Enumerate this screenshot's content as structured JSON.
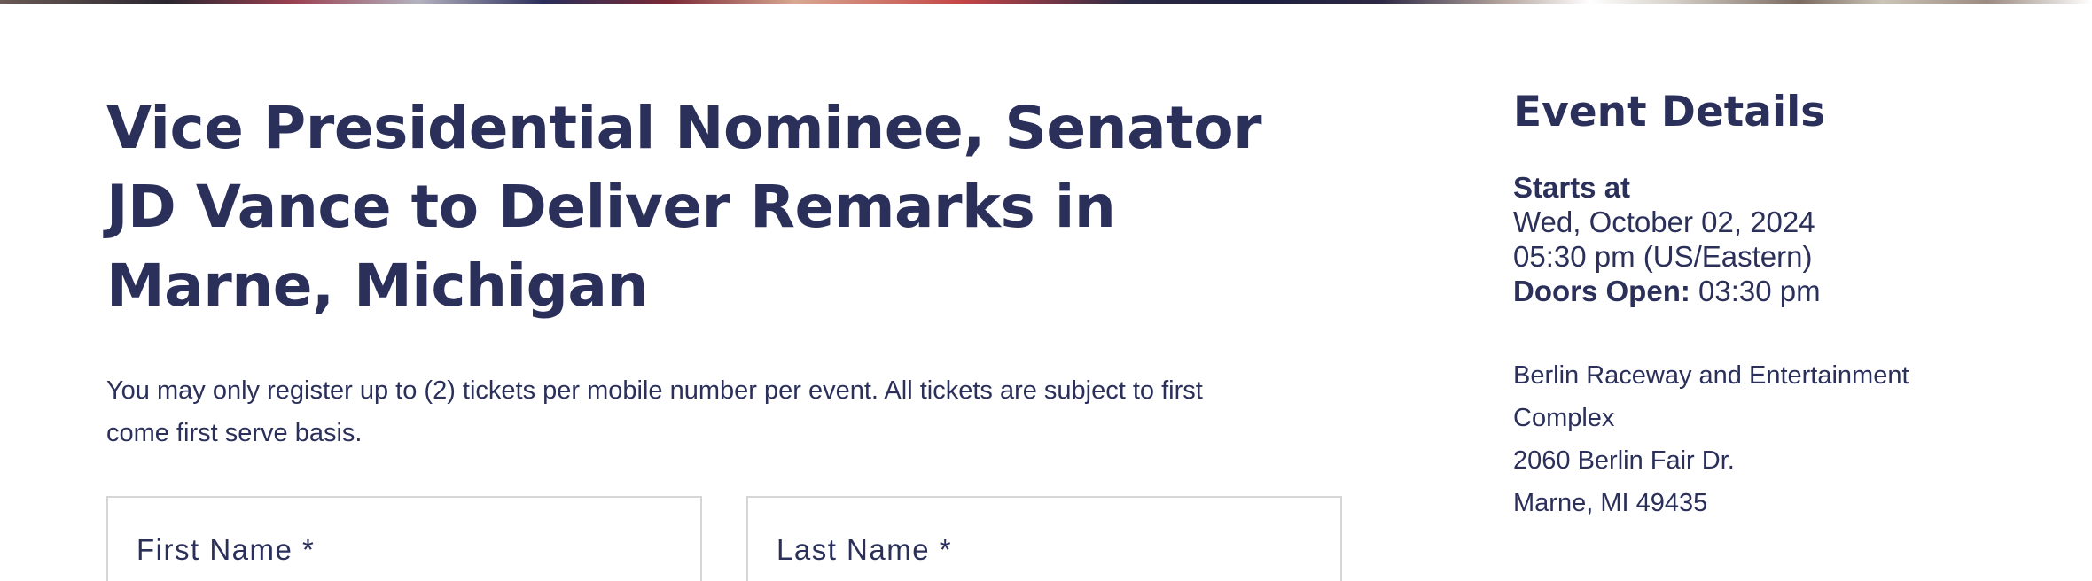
{
  "header": {
    "banner_colors": [
      "#6b5a55",
      "#2a2630",
      "#9a4050",
      "#2a2d5a",
      "#c54545",
      "#1d2040",
      "#ffffff"
    ]
  },
  "event": {
    "title_lines": [
      "Vice Presidential Nominee, Senator",
      "JD Vance to Deliver Remarks in",
      "Marne, Michigan"
    ],
    "notice_lines": [
      "You may only register up to (2) tickets per mobile number per event. All tickets are subject to first",
      "come first serve basis."
    ]
  },
  "form": {
    "first_name_label": "First Name *",
    "last_name_label": "Last Name *"
  },
  "details": {
    "heading": "Event Details",
    "starts_label": "Starts at",
    "start_date": "Wed, October 02, 2024",
    "start_time": "05:30 pm (US/Eastern)",
    "doors_label": "Doors Open:",
    "doors_time": "03:30 pm",
    "venue_lines": [
      "Berlin Raceway and Entertainment",
      "Complex",
      "2060 Berlin Fair Dr.",
      "Marne, MI 49435"
    ]
  },
  "colors": {
    "text_primary": "#2b305a",
    "field_border": "#d6d6d6",
    "background": "#ffffff"
  }
}
